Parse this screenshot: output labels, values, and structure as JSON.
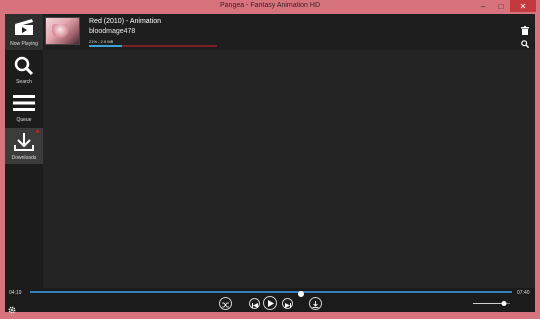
{
  "window": {
    "title": "Pangea - Fantasy Animation HD"
  },
  "sidebar": {
    "items": [
      {
        "label": "Now Playing",
        "icon": "clapperboard-icon"
      },
      {
        "label": "Search",
        "icon": "search-icon"
      },
      {
        "label": "Queue",
        "icon": "queue-list-icon"
      },
      {
        "label": "Downloads",
        "icon": "download-icon"
      }
    ]
  },
  "now_playing": {
    "title": "Red (2010) - Animation",
    "user": "bloodmage478",
    "progress_text": "21% - 2.9 MB",
    "download_fraction": 0.26
  },
  "player": {
    "elapsed": "04:19",
    "total": "07:40",
    "seek_fraction": 0.563,
    "volume_fraction": 0.85
  },
  "colors": {
    "accent_blue": "#3aa4d8",
    "track_red": "#7a1d24",
    "chrome_pink": "#d7737d"
  }
}
